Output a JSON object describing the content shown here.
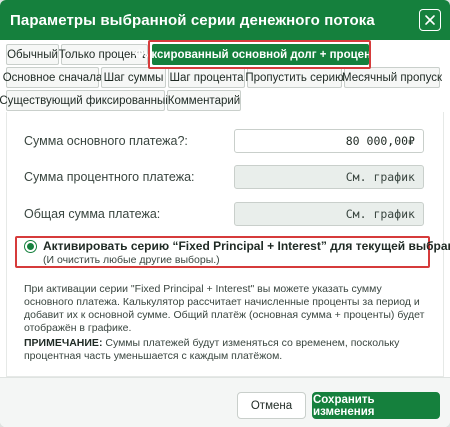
{
  "dialog": {
    "title": "Параметры выбранной серии денежного потока",
    "close_icon": "close-icon"
  },
  "tabs": {
    "row1": [
      "Обычный",
      "Только проценты",
      "Фиксированный основной долг + проценты"
    ],
    "row2": [
      "Основное сначала",
      "Шаг суммы",
      "Шаг процента",
      "Пропустить серию",
      "Месячный пропуск"
    ],
    "row3": [
      "Существующий фиксированный",
      "Комментарий"
    ],
    "active": "Фиксированный основной долг + проценты"
  },
  "fields": {
    "principal_label": "Сумма основного платежа?:",
    "principal_value": "80 000,00₽",
    "interest_label": "Сумма процентного платежа:",
    "interest_value": "См. график",
    "total_label": "Общая сумма платежа:",
    "total_value": "См. график"
  },
  "option": {
    "title": "Активировать серию “Fixed Principal + Interest” для текущей выбранной серии.",
    "subtitle": "(И очистить любые другие выборы.)",
    "selected": true
  },
  "description": "При активации серии \"Fixed Principal + Interest\" вы можете указать сумму основного платежа. Калькулятор рассчитает начисленные проценты за период и добавит их к основной сумме. Общий платёж (основная сумма + проценты) будет отображён в графике.",
  "note": {
    "label": "ПРИМЕЧАНИЕ:",
    "text": " Суммы платежей будут изменяться со временем, поскольку процентная часть уменьшается с каждым платёжом."
  },
  "buttons": {
    "cancel": "Отмена",
    "save": "Сохранить изменения"
  },
  "colors": {
    "accent": "#15803d",
    "highlight": "#d63b3b"
  }
}
